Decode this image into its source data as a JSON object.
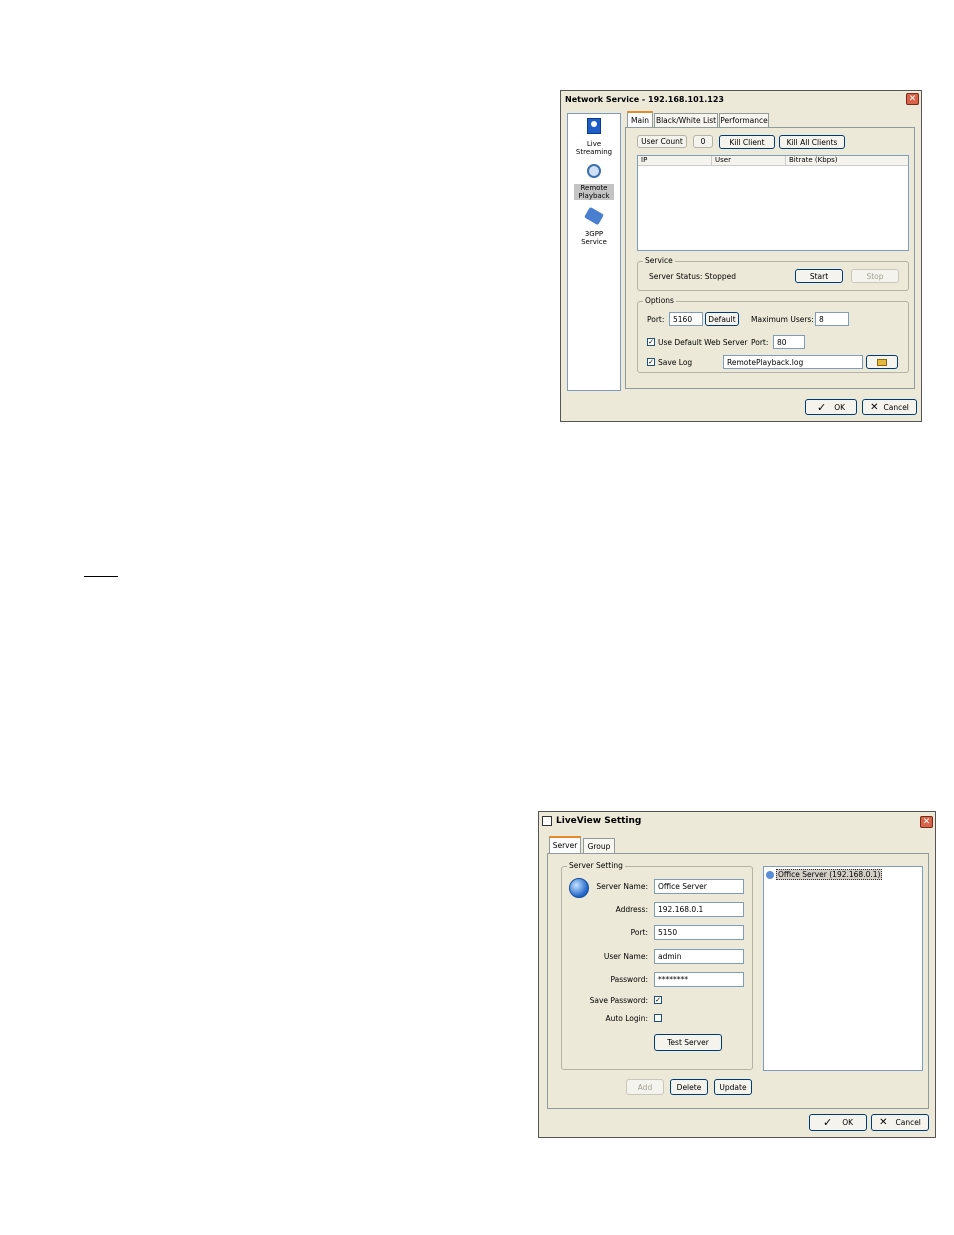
{
  "network_service": {
    "title": "Network Service - 192.168.101.123",
    "sidebar": [
      {
        "label_line1": "Live",
        "label_line2": "Streaming",
        "icon": "live-streaming-icon"
      },
      {
        "label_line1": "Remote",
        "label_line2": "Playback",
        "icon": "remote-playback-icon"
      },
      {
        "label_line1": "3GPP",
        "label_line2": "Service",
        "icon": "3gpp-phone-icon"
      }
    ],
    "tabs": [
      "Main",
      "Black/White List",
      "Performance"
    ],
    "user_count_label": "User Count",
    "user_count_value": "0",
    "kill_client": "Kill Client",
    "kill_all_clients": "Kill All Clients",
    "columns": [
      "IP",
      "User",
      "Bitrate (Kbps)"
    ],
    "service_group": "Service",
    "server_status": "Server Status: Stopped",
    "start": "Start",
    "stop": "Stop",
    "options_group": "Options",
    "port_label": "Port:",
    "port_value": "5160",
    "default_btn": "Default",
    "max_users_label": "Maximum Users:",
    "max_users_value": "8",
    "use_default_web": "Use Default Web Server",
    "web_port_label": "Port:",
    "web_port_value": "80",
    "save_log": "Save Log",
    "log_file": "RemotePlayback.log",
    "ok": "OK",
    "cancel": "Cancel"
  },
  "liveview": {
    "title": "LiveView Setting",
    "tabs": [
      "Server",
      "Group"
    ],
    "server_setting_group": "Server Setting",
    "server_name_label": "Server Name:",
    "server_name_value": "Office Server",
    "address_label": "Address:",
    "address_value": "192.168.0.1",
    "port_label": "Port:",
    "port_value": "5150",
    "username_label": "User Name:",
    "username_value": "admin",
    "password_label": "Password:",
    "password_value": "********",
    "save_password_label": "Save Password:",
    "auto_login_label": "Auto Login:",
    "test_server": "Test Server",
    "tree_item": "Office Server (192.168.0.1)",
    "add": "Add",
    "delete": "Delete",
    "update": "Update",
    "ok": "OK",
    "cancel": "Cancel"
  }
}
